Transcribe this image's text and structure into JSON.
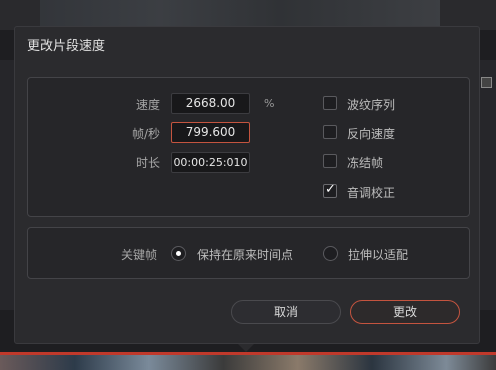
{
  "dialog": {
    "title": "更改片段速度"
  },
  "speed": {
    "label": "速度",
    "value": "2668.00",
    "unit": "%"
  },
  "fps": {
    "label": "帧/秒",
    "value": "799.600"
  },
  "duration": {
    "label": "时长",
    "value": "00:00:25:010"
  },
  "options": {
    "ripple_sequence": {
      "label": "波纹序列",
      "checked": false
    },
    "reverse_speed": {
      "label": "反向速度",
      "checked": false
    },
    "freeze_frame": {
      "label": "冻结帧",
      "checked": false
    },
    "pitch_correction": {
      "label": "音调校正",
      "checked": true
    }
  },
  "keyframes": {
    "label": "关键帧",
    "option_keep": "保持在原来时间点",
    "option_stretch": "拉伸以适配",
    "selected": "option_keep"
  },
  "buttons": {
    "cancel": "取消",
    "change": "更改"
  },
  "colors": {
    "accent": "#c4543f",
    "background": "#2b2b2e"
  }
}
